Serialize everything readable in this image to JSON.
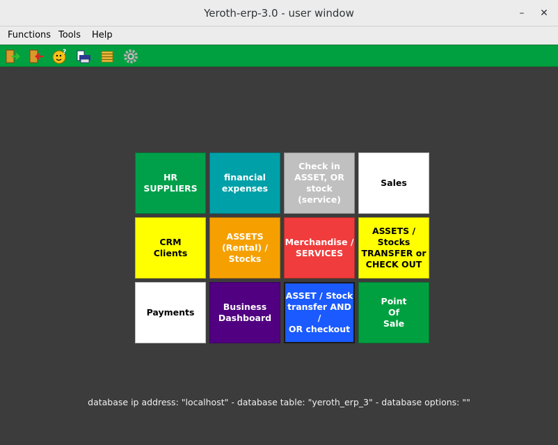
{
  "window": {
    "title": "Yeroth-erp-3.0 - user window",
    "minimize_glyph": "–",
    "close_glyph": "✕"
  },
  "menu": {
    "items": [
      "Functions",
      "Tools",
      "Help"
    ]
  },
  "toolbar": {
    "icons": [
      "door-enter-icon",
      "door-exit-icon",
      "smiley-help-icon",
      "printer-icon",
      "stacked-coins-icon",
      "gear-icon"
    ]
  },
  "tiles": [
    {
      "label": "HR\nSUPPLIERS",
      "bg": "#00a04a",
      "fg": "#ffffff"
    },
    {
      "label": "financial\nexpenses",
      "bg": "#00a0a8",
      "fg": "#ffffff"
    },
    {
      "label": "Check in\nASSET, OR\nstock (service)",
      "bg": "#c0c0c0",
      "fg": "#ffffff"
    },
    {
      "label": "Sales",
      "bg": "#ffffff",
      "fg": "#000000"
    },
    {
      "label": "CRM\nClients",
      "bg": "#ffff00",
      "fg": "#000000"
    },
    {
      "label": "ASSETS\n(Rental) /\nStocks",
      "bg": "#f5a000",
      "fg": "#ffffff"
    },
    {
      "label": "Merchandise /\nSERVICES",
      "bg": "#f03c3c",
      "fg": "#ffffff"
    },
    {
      "label": "ASSETS / Stocks\nTRANSFER or\nCHECK OUT",
      "bg": "#ffff00",
      "fg": "#000000"
    },
    {
      "label": "Payments",
      "bg": "#ffffff",
      "fg": "#000000"
    },
    {
      "label": "Business\nDashboard",
      "bg": "#500080",
      "fg": "#ffffff"
    },
    {
      "label": "ASSET / Stock\ntransfer AND /\nOR checkout",
      "bg": "#1a5aff",
      "fg": "#ffffff"
    },
    {
      "label": "Point\nOf\nSale",
      "bg": "#00a040",
      "fg": "#ffffff"
    }
  ],
  "status": {
    "db_info": "database ip address: \"localhost\" - database table: \"yeroth_erp_3\" - database options: \"\""
  }
}
